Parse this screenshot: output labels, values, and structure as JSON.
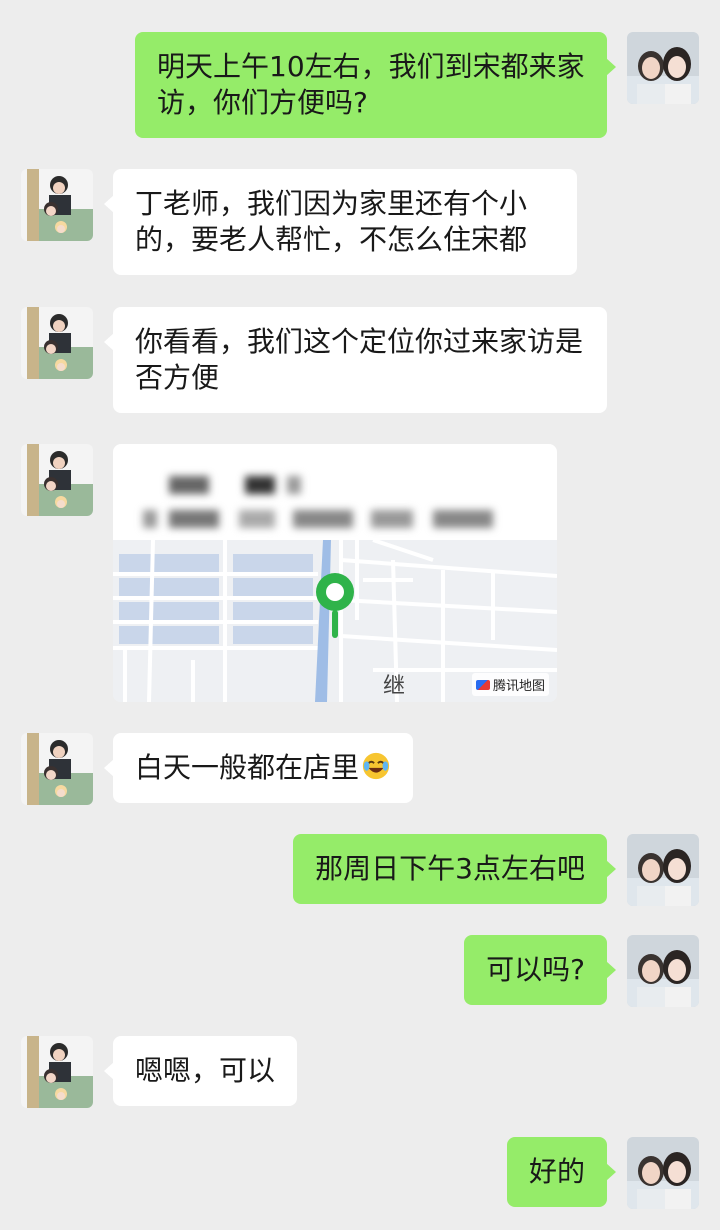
{
  "messages": [
    {
      "sender": "me",
      "text": "明天上午10左右，我们到宋都来家访，你们方便吗?"
    },
    {
      "sender": "them",
      "text": "丁老师，我们因为家里还有个小的，要老人帮忙，不怎么住宋都"
    },
    {
      "sender": "them",
      "text": "你看看，我们这个定位你过来家访是否方便"
    },
    {
      "sender": "them",
      "type": "location",
      "map_label": "继",
      "map_provider": "腾讯地图"
    },
    {
      "sender": "them",
      "text": "白天一般都在店里",
      "emoji": "face-with-tears-of-joy"
    },
    {
      "sender": "me",
      "text": "那周日下午3点左右吧"
    },
    {
      "sender": "me",
      "text": "可以吗?"
    },
    {
      "sender": "them",
      "text": "嗯嗯，可以"
    },
    {
      "sender": "me",
      "text": "好的"
    }
  ],
  "colors": {
    "background": "#ededed",
    "my_bubble": "#95ec69",
    "their_bubble": "#ffffff",
    "map_pin": "#2fb34a"
  },
  "icons": {
    "my_avatar": "two-girls-photo-avatar",
    "their_avatar": "family-photo-avatar",
    "map_pin": "location-pin-icon",
    "map_logo": "tencent-maps-logo"
  }
}
